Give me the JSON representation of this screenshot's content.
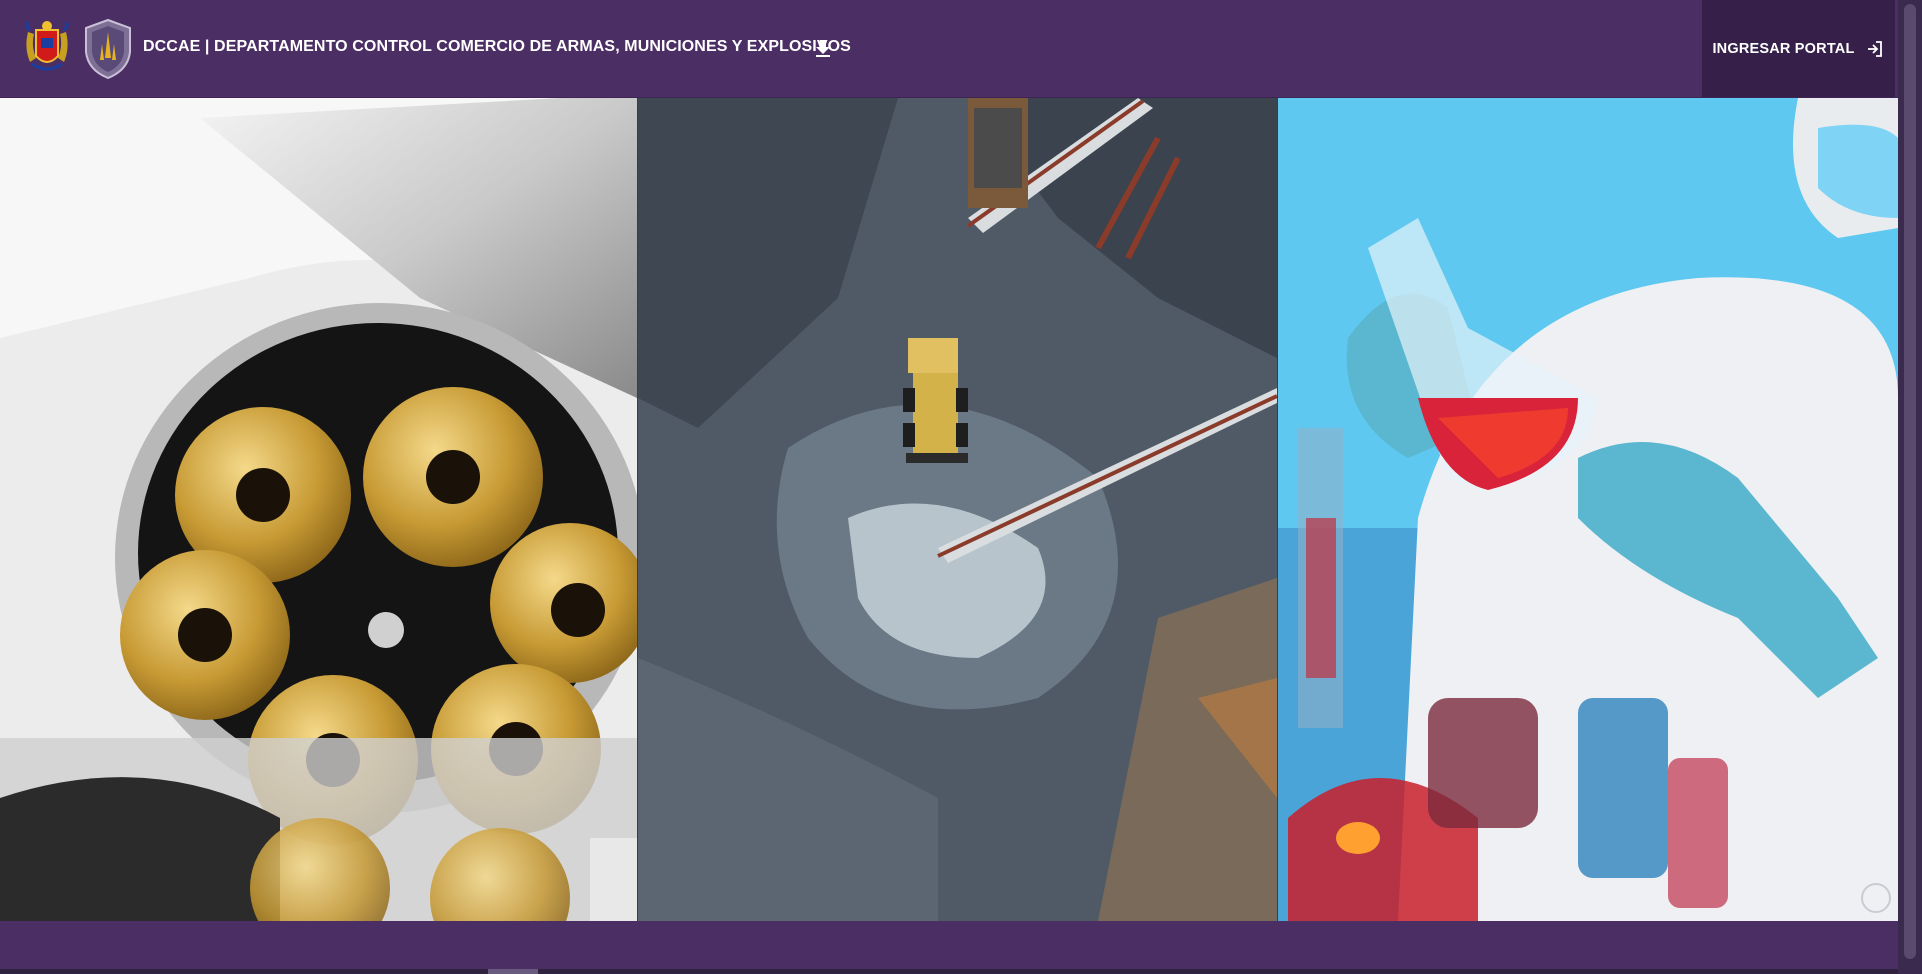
{
  "header": {
    "title": "DCCAE | DEPARTAMENTO CONTROL COMERCIO DE ARMAS, MUNICIONES Y EXPLOSIVOS",
    "download_icon": "download-icon",
    "login_label": "INGRESAR PORTAL",
    "login_icon": "login-icon"
  },
  "panels": [
    {
      "subject": "revolver-cylinder-ammunition"
    },
    {
      "subject": "open-pit-mine-loader-conveyors"
    },
    {
      "subject": "laboratory-chemist-flask"
    }
  ],
  "colors": {
    "header_bg": "#4b2e63",
    "login_bg": "#36204a",
    "text": "#ffffff"
  }
}
